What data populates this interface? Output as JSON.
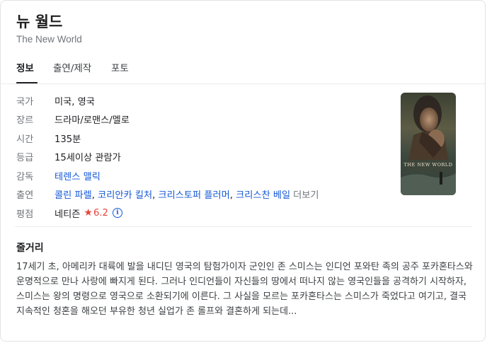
{
  "header": {
    "title": "뉴 월드",
    "subtitle": "The New World"
  },
  "tabs": [
    {
      "label": "정보",
      "active": true
    },
    {
      "label": "출연/제작",
      "active": false
    },
    {
      "label": "포토",
      "active": false
    }
  ],
  "info": {
    "country": {
      "label": "국가",
      "value": "미국, 영국"
    },
    "genre": {
      "label": "장르",
      "value": "드라마/로맨스/멜로"
    },
    "runtime": {
      "label": "시간",
      "value": "135분"
    },
    "rating_grade": {
      "label": "등급",
      "value": "15세이상 관람가"
    },
    "director": {
      "label": "감독",
      "value": "테렌스 맬릭"
    },
    "cast": {
      "label": "출연",
      "names": [
        "콜린 파렐",
        "코리안카 킬처",
        "크리스토퍼 플러머",
        "크리스찬 베일"
      ],
      "separator": ", ",
      "more_label": "더보기"
    },
    "score": {
      "label": "평점",
      "source": "네티즌",
      "star": "★",
      "value": "6.2",
      "info_icon": "i"
    }
  },
  "poster": {
    "alt": "The New World poster",
    "poster_text": "THE NEW WORLD"
  },
  "plot": {
    "heading": "줄거리",
    "text": "17세기 초, 아메리카 대륙에 발을 내디딘 영국의 탐험가이자 군인인 존 스미스는 인디언 포와탄 족의 공주 포카혼타스와 운명적으로 만나 사랑에 빠지게 된다. 그러나 인디언들이 자신들의 땅에서 떠나지 않는 영국인들을 공격하기 시작하자, 스미스는 왕의 명령으로 영국으로 소환되기에 이른다. 그 사실을 모르는 포카혼타스는 스미스가 죽었다고 여기고, 결국 지속적인 청혼을 해오던 부유한 청년 실업가 존 롤프와 결혼하게 되는데..."
  },
  "colors": {
    "link": "#1558d6",
    "star": "#e8453c",
    "label": "#70757a"
  }
}
